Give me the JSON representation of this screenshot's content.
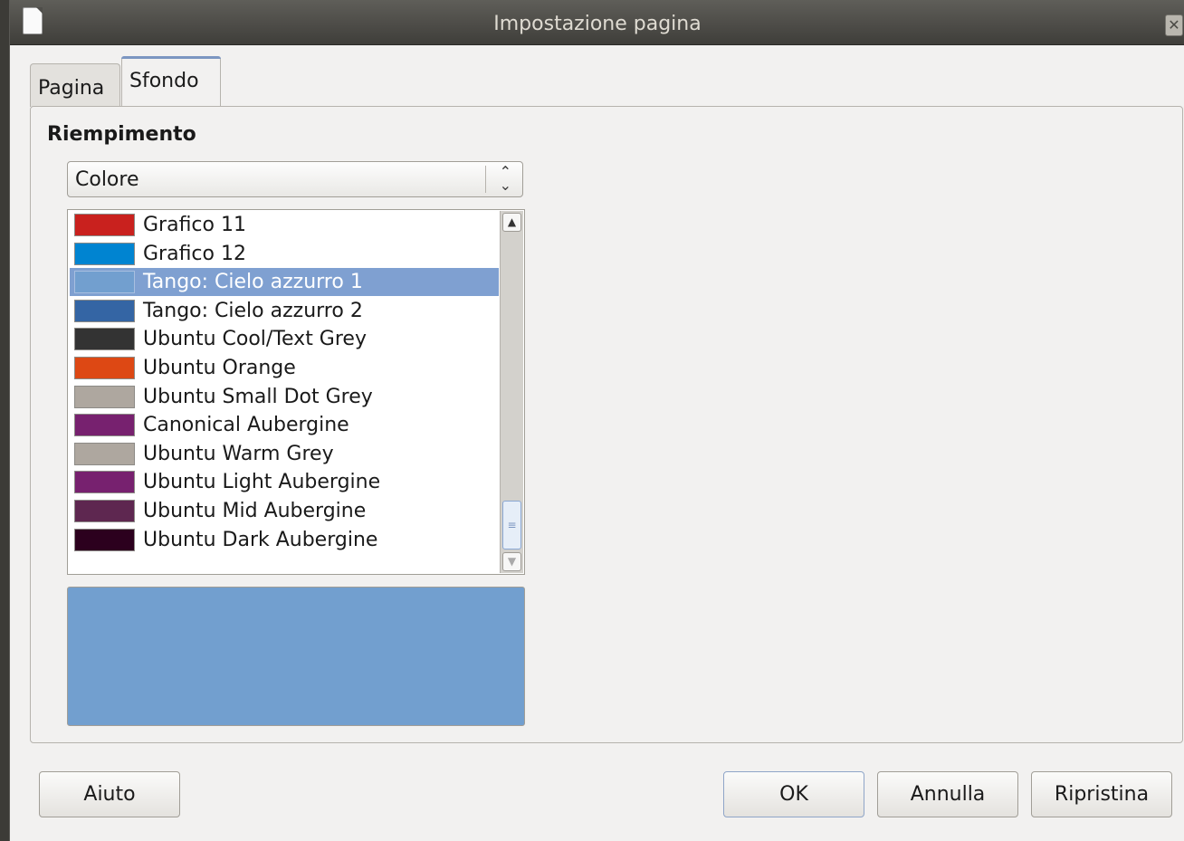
{
  "window": {
    "title": "Impostazione pagina"
  },
  "tabs": [
    {
      "label": "Pagina",
      "active": false
    },
    {
      "label": "Sfondo",
      "active": true
    }
  ],
  "fill": {
    "section_label": "Riempimento",
    "type_select": {
      "value": "Colore"
    },
    "colors": [
      {
        "name": "Grafico 11",
        "color": "#c9211e",
        "selected": false
      },
      {
        "name": "Grafico 12",
        "color": "#0084d1",
        "selected": false
      },
      {
        "name": "Tango: Cielo azzurro 1",
        "color": "#729fcf",
        "selected": true
      },
      {
        "name": "Tango: Cielo azzurro 2",
        "color": "#3465a4",
        "selected": false
      },
      {
        "name": "Ubuntu Cool/Text Grey",
        "color": "#333333",
        "selected": false
      },
      {
        "name": "Ubuntu Orange",
        "color": "#dd4814",
        "selected": false
      },
      {
        "name": "Ubuntu Small Dot Grey",
        "color": "#aea79f",
        "selected": false
      },
      {
        "name": "Canonical Aubergine",
        "color": "#77216f",
        "selected": false
      },
      {
        "name": "Ubuntu Warm Grey",
        "color": "#aea79f",
        "selected": false
      },
      {
        "name": "Ubuntu Light Aubergine",
        "color": "#77216f",
        "selected": false
      },
      {
        "name": "Ubuntu Mid Aubergine",
        "color": "#5e2750",
        "selected": false
      },
      {
        "name": "Ubuntu Dark Aubergine",
        "color": "#2c001e",
        "selected": false
      }
    ],
    "preview_color": "#729fcf"
  },
  "buttons": {
    "help": "Aiuto",
    "ok": "OK",
    "cancel": "Annulla",
    "reset": "Ripristina"
  }
}
